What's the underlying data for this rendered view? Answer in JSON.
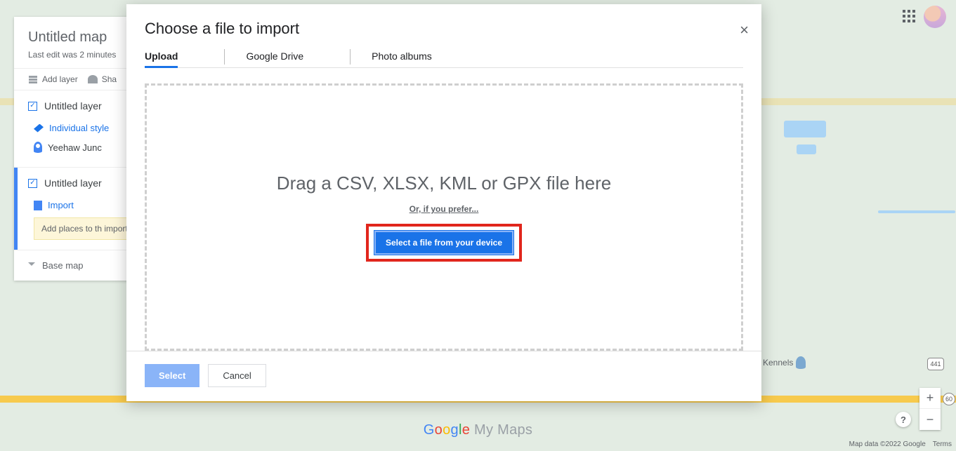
{
  "side_panel": {
    "title": "Untitled map",
    "subtitle": "Last edit was 2 minutes",
    "toolbar": {
      "add_layer": "Add layer",
      "share": "Sha"
    },
    "layer_a": {
      "title": "Untitled layer",
      "style_label": "Individual style",
      "place_label": "Yeehaw Junc"
    },
    "layer_b": {
      "title": "Untitled layer",
      "import_label": "Import",
      "note": "Add places to th importing data."
    },
    "base_map": "Base map"
  },
  "modal": {
    "title": "Choose a file to import",
    "tabs": {
      "upload": "Upload",
      "drive": "Google Drive",
      "photos": "Photo albums"
    },
    "drop_big": "Drag a CSV, XLSX, KML or GPX file here",
    "drop_or": "Or, if you prefer...",
    "select_btn": "Select a file from your device",
    "footer": {
      "select": "Select",
      "cancel": "Cancel"
    }
  },
  "logo": {
    "brand_letters": [
      "G",
      "o",
      "o",
      "g",
      "l",
      "e"
    ],
    "suffix": " My Maps"
  },
  "zoom": {
    "in": "+",
    "out": "−"
  },
  "help": "?",
  "poi": {
    "kennels": "Kennels"
  },
  "road_shields": {
    "r441": "441",
    "r60": "60"
  },
  "attribution": {
    "data": "Map data ©2022 Google",
    "terms": "Terms"
  }
}
